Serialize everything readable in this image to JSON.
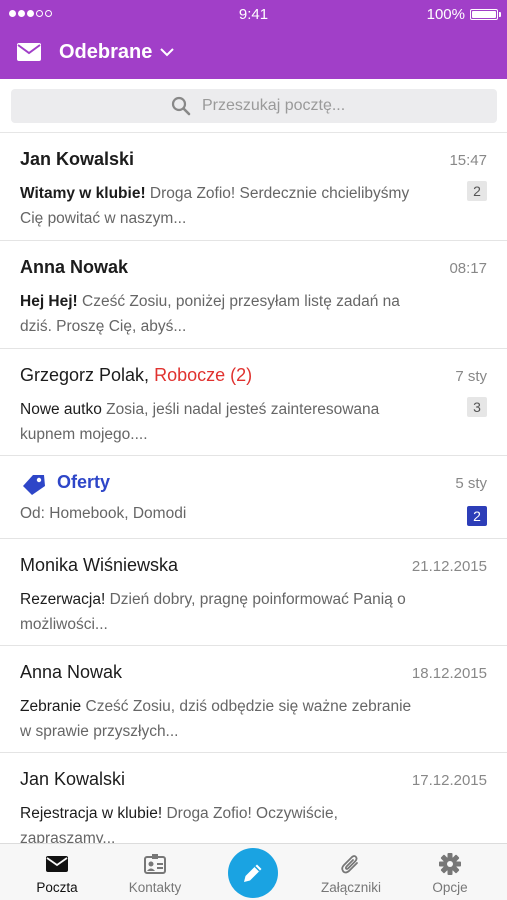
{
  "status": {
    "time": "9:41",
    "battery": "100%"
  },
  "header": {
    "title": "Odebrane",
    "icon": "mail-icon"
  },
  "search": {
    "placeholder": "Przeszukaj pocztę..."
  },
  "messages": [
    {
      "sender": "Jan Kowalski",
      "time": "15:47",
      "subject": "Witamy w klubie!",
      "preview": " Droga Zofio! Serdecznie chcielibyśmy Cię powitać w naszym...",
      "count": "2",
      "unread": true
    },
    {
      "sender": "Anna Nowak",
      "time": "08:17",
      "subject": "Hej Hej!",
      "preview": " Cześć Zosiu, poniżej przesyłam listę zadań na dziś. Proszę Cię, abyś...",
      "unread": true
    },
    {
      "sender": "Grzegorz Polak,",
      "draft": "Robocze (2)",
      "time": "7 sty",
      "subject": "Nowe autko",
      "preview": " Zosia, jeśli nadal jesteś zainteresowana kupnem mojego....",
      "count": "3",
      "unread": false
    },
    {
      "sender": "Monika Wiśniewska",
      "time": "21.12.2015",
      "subject": "Rezerwacja!",
      "preview": " Dzień dobry, pragnę poinformować Panią o możliwości...",
      "unread": false
    },
    {
      "sender": "Anna Nowak",
      "time": "18.12.2015",
      "subject": "Zebranie",
      "preview": " Cześć Zosiu, dziś odbędzie się ważne zebranie w sprawie przyszłych...",
      "unread": false
    },
    {
      "sender": "Jan Kowalski",
      "time": "17.12.2015",
      "subject": "Rejestracja w klubie!",
      "preview": " Droga Zofio! Oczywiście, zapraszamy...",
      "unread": false
    }
  ],
  "offers": {
    "title": "Oferty",
    "from": "Od: Homebook, Domodi",
    "time": "5 sty",
    "count": "2",
    "icon": "tag-icon"
  },
  "tabs": [
    {
      "label": "Poczta",
      "icon": "mail-icon",
      "active": true
    },
    {
      "label": "Kontakty",
      "icon": "contacts-icon"
    },
    {
      "label": "",
      "icon": "compose-pencil-icon"
    },
    {
      "label": "Załączniki",
      "icon": "paperclip-icon"
    },
    {
      "label": "Opcje",
      "icon": "gear-icon"
    }
  ],
  "colors": {
    "header": "#a13fc8",
    "draft": "#e0322f",
    "offers": "#2e46c8",
    "compose": "#1aa3e2"
  }
}
